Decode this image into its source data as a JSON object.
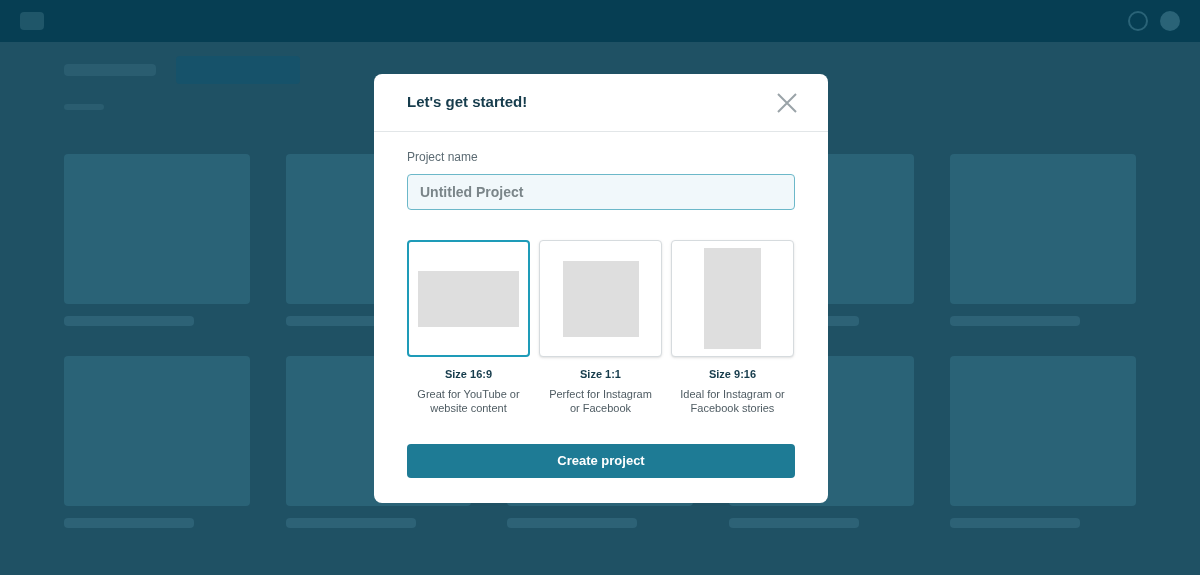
{
  "dialog": {
    "title": "Let's get started!",
    "field": {
      "label": "Project name",
      "placeholder": "Untitled Project"
    },
    "sizes": [
      {
        "kind": "wide",
        "title": "Size 16:9",
        "description": "Great for YouTube or website content",
        "selected": true
      },
      {
        "kind": "square",
        "title": "Size 1:1",
        "description": "Perfect for Instagram or Facebook",
        "selected": false
      },
      {
        "kind": "tall",
        "title": "Size 9:16",
        "description": "Ideal for Instagram or Facebook stories",
        "selected": false
      }
    ],
    "button": "Create project"
  }
}
